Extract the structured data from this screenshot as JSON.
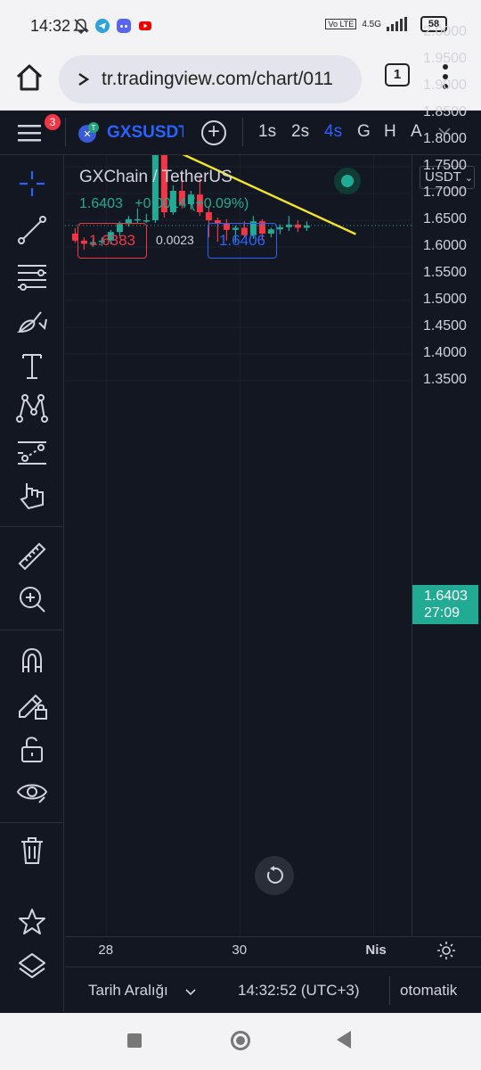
{
  "status_bar": {
    "time": "14:32",
    "network": "4.5G",
    "volte": "Vo LTE",
    "battery": "58",
    "icons": [
      "mute-bell-icon",
      "telegram-icon",
      "discord-icon",
      "youtube-icon"
    ]
  },
  "browser": {
    "url": "tr.tradingview.com/chart/011",
    "tab_count": "1",
    "icons": [
      "home-icon",
      "site-settings-icon",
      "more-vert-icon"
    ]
  },
  "toolbar": {
    "notification_count": "3",
    "symbol": "GXSUSDT",
    "add_symbol": "+",
    "timeframes": [
      {
        "label": "1s",
        "active": false
      },
      {
        "label": "2s",
        "active": false
      },
      {
        "label": "4s",
        "active": true
      },
      {
        "label": "G",
        "active": false
      },
      {
        "label": "H",
        "active": false
      },
      {
        "label": "A",
        "active": false
      }
    ]
  },
  "legend": {
    "title": "GXChain / TetherUS",
    "last": "1.6403",
    "change": "+0.0014",
    "change_pct": "(+0.09%)",
    "sell": "1.6383",
    "spread": "0.0023",
    "buy": "1.6406"
  },
  "left_tools": [
    "crosshair-icon",
    "trend-line-icon",
    "fib-retracement-icon",
    "brush-icon",
    "text-icon",
    "pattern-icon",
    "prediction-icon",
    "gesture-icon",
    "ruler-icon",
    "zoom-in-icon",
    "magnet-icon",
    "lock-drawing-icon",
    "unlock-icon",
    "eye-icon",
    "trash-icon",
    "star-icon",
    "layers-icon"
  ],
  "price_axis": {
    "currency": "USDT",
    "ticks": [
      "2.0000",
      "1.9500",
      "1.9000",
      "1.8500",
      "1.8000",
      "1.7500",
      "1.7000",
      "1.6500",
      "1.6000",
      "1.5500",
      "1.5000",
      "1.4500",
      "1.4000",
      "1.3500"
    ],
    "current_price": "1.6403",
    "countdown": "27:09"
  },
  "time_axis": {
    "ticks": [
      {
        "label": "28",
        "bold": false
      },
      {
        "label": "30",
        "bold": false
      },
      {
        "label": "Nis",
        "bold": true
      }
    ]
  },
  "bottom_bar": {
    "date_range": "Tarih Aralığı",
    "clock": "14:32:52 (UTC+3)",
    "scale": "otomatik"
  },
  "colors": {
    "up": "#22ab94",
    "down": "#f23645",
    "accent": "#2962ff",
    "trendline": "#f5e623",
    "background": "#131722"
  },
  "chart_data": {
    "type": "candlestick",
    "symbol": "GXSUSDT",
    "ylim": [
      1.3,
      2.05
    ],
    "current_price": 1.6403,
    "candles": [
      {
        "o": 1.625,
        "h": 1.635,
        "l": 1.608,
        "c": 1.612
      },
      {
        "o": 1.612,
        "h": 1.618,
        "l": 1.595,
        "c": 1.606
      },
      {
        "o": 1.606,
        "h": 1.615,
        "l": 1.6,
        "c": 1.609
      },
      {
        "o": 1.609,
        "h": 1.618,
        "l": 1.602,
        "c": 1.612
      },
      {
        "o": 1.612,
        "h": 1.632,
        "l": 1.605,
        "c": 1.628
      },
      {
        "o": 1.628,
        "h": 1.648,
        "l": 1.62,
        "c": 1.643
      },
      {
        "o": 1.643,
        "h": 1.658,
        "l": 1.638,
        "c": 1.652
      },
      {
        "o": 1.652,
        "h": 1.672,
        "l": 1.645,
        "c": 1.652
      },
      {
        "o": 1.65,
        "h": 1.662,
        "l": 1.645,
        "c": 1.65
      },
      {
        "o": 1.65,
        "h": 1.795,
        "l": 1.645,
        "c": 1.785
      },
      {
        "o": 1.785,
        "h": 1.792,
        "l": 1.655,
        "c": 1.665
      },
      {
        "o": 1.665,
        "h": 1.715,
        "l": 1.66,
        "c": 1.705
      },
      {
        "o": 1.705,
        "h": 1.738,
        "l": 1.672,
        "c": 1.68
      },
      {
        "o": 1.68,
        "h": 1.705,
        "l": 1.67,
        "c": 1.698
      },
      {
        "o": 1.698,
        "h": 1.73,
        "l": 1.658,
        "c": 1.665
      },
      {
        "o": 1.665,
        "h": 1.675,
        "l": 1.618,
        "c": 1.65
      },
      {
        "o": 1.65,
        "h": 1.655,
        "l": 1.61,
        "c": 1.645
      },
      {
        "o": 1.645,
        "h": 1.652,
        "l": 1.612,
        "c": 1.632
      },
      {
        "o": 1.632,
        "h": 1.64,
        "l": 1.608,
        "c": 1.636
      },
      {
        "o": 1.636,
        "h": 1.648,
        "l": 1.618,
        "c": 1.622
      },
      {
        "o": 1.622,
        "h": 1.658,
        "l": 1.615,
        "c": 1.648
      },
      {
        "o": 1.648,
        "h": 1.652,
        "l": 1.612,
        "c": 1.625
      },
      {
        "o": 1.625,
        "h": 1.636,
        "l": 1.618,
        "c": 1.633
      },
      {
        "o": 1.633,
        "h": 1.642,
        "l": 1.624,
        "c": 1.637
      },
      {
        "o": 1.637,
        "h": 1.658,
        "l": 1.63,
        "c": 1.642
      },
      {
        "o": 1.642,
        "h": 1.65,
        "l": 1.628,
        "c": 1.636
      },
      {
        "o": 1.636,
        "h": 1.648,
        "l": 1.63,
        "c": 1.6403
      }
    ],
    "trendline": {
      "from": [
        9,
        1.797
      ],
      "to": [
        31.5,
        1.624
      ]
    },
    "x_ticks": [
      {
        "label": "28",
        "index": 3.5
      },
      {
        "label": "30",
        "index": 18.5
      },
      {
        "label": "Nis",
        "index": 33.5
      }
    ]
  }
}
